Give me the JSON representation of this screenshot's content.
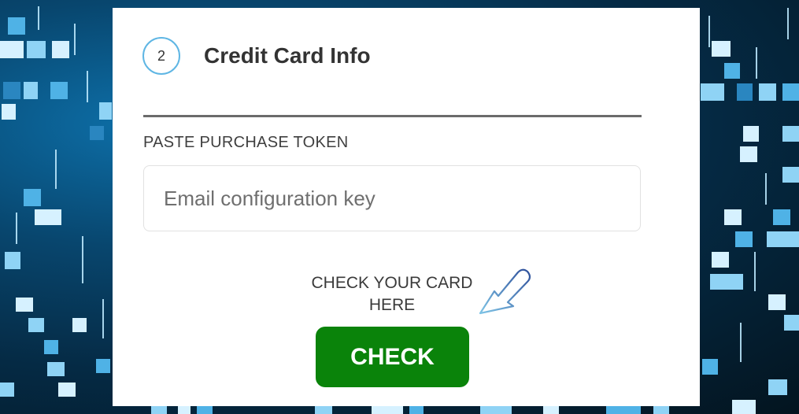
{
  "step": {
    "number": "2",
    "title": "Credit Card Info"
  },
  "form": {
    "label": "PASTE PURCHASE TOKEN",
    "input_value": "",
    "input_placeholder": "Email configuration key"
  },
  "hint": {
    "line1": "CHECK YOUR CARD",
    "line2": "HERE"
  },
  "check_button_label": "CHECK",
  "icons": {
    "hint_arrow": "arrow-pointing-down-left-icon"
  },
  "colors": {
    "accent_circle": "#5fb6e4",
    "check_button": "#0a830a",
    "background_dark": "#052a44",
    "background_tile": "#8fd3f5"
  }
}
